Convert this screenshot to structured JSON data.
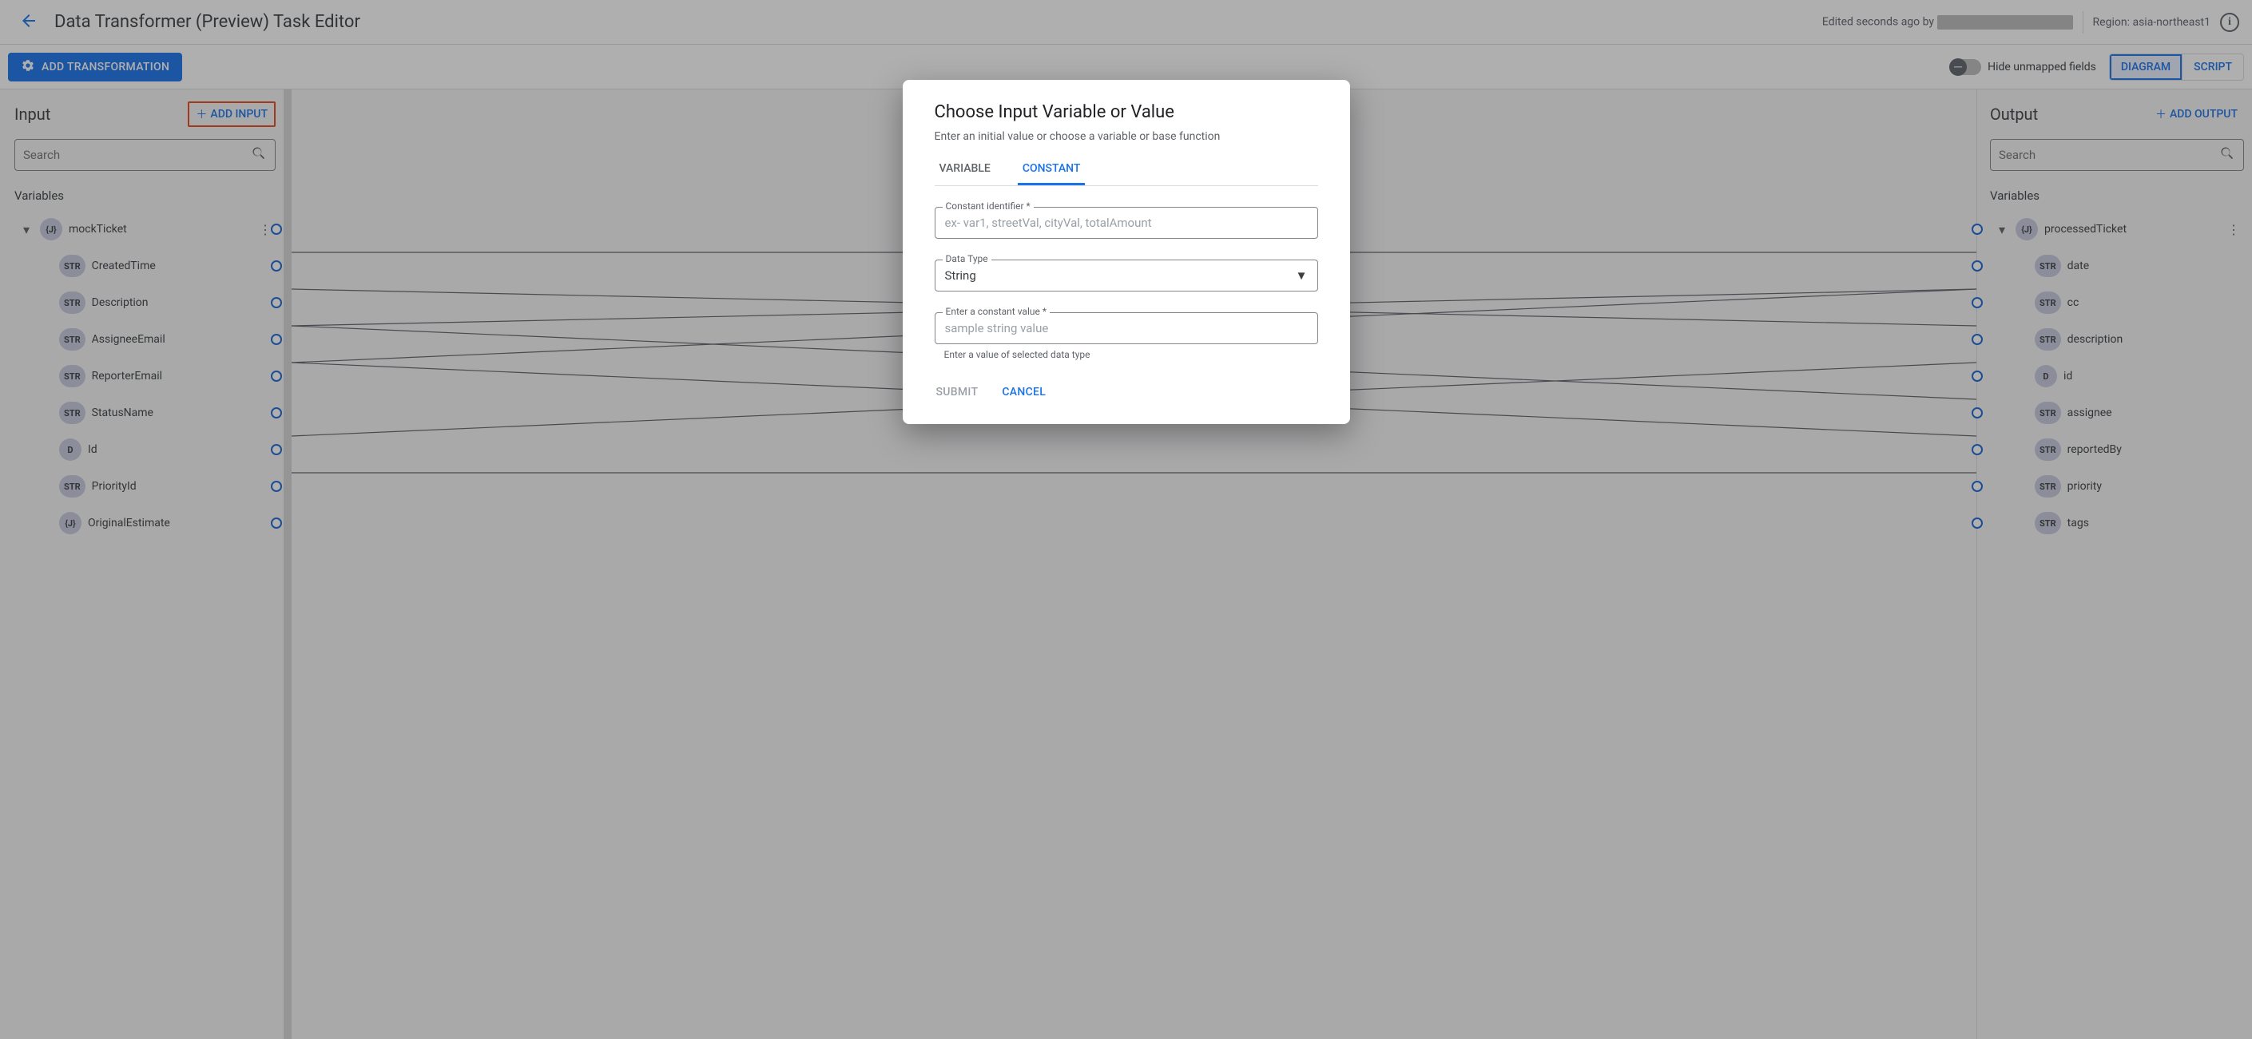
{
  "header": {
    "title": "Data Transformer (Preview) Task Editor",
    "edited_prefix": "Edited seconds ago by",
    "region_label": "Region:",
    "region_value": "asia-northeast1"
  },
  "toolbar": {
    "add_transformation": "ADD TRANSFORMATION",
    "hide_unmapped": "Hide unmapped fields",
    "view_diagram": "DIAGRAM",
    "view_script": "SCRIPT"
  },
  "input_panel": {
    "title": "Input",
    "add_btn": "ADD INPUT",
    "search_placeholder": "Search",
    "variables_label": "Variables",
    "root": {
      "type": "json",
      "name": "mockTicket"
    },
    "fields": [
      {
        "type": "STR",
        "name": "CreatedTime"
      },
      {
        "type": "STR",
        "name": "Description"
      },
      {
        "type": "STR",
        "name": "AssigneeEmail"
      },
      {
        "type": "STR",
        "name": "ReporterEmail"
      },
      {
        "type": "STR",
        "name": "StatusName"
      },
      {
        "type": "D",
        "name": "Id"
      },
      {
        "type": "STR",
        "name": "PriorityId"
      },
      {
        "type": "{J}",
        "name": "OriginalEstimate"
      }
    ]
  },
  "output_panel": {
    "title": "Output",
    "add_btn": "ADD OUTPUT",
    "search_placeholder": "Search",
    "variables_label": "Variables",
    "root": {
      "type": "json",
      "name": "processedTicket"
    },
    "fields": [
      {
        "type": "STR",
        "name": "date"
      },
      {
        "type": "STR",
        "name": "cc"
      },
      {
        "type": "STR",
        "name": "description"
      },
      {
        "type": "D",
        "name": "id"
      },
      {
        "type": "STR",
        "name": "assignee"
      },
      {
        "type": "STR",
        "name": "reportedBy"
      },
      {
        "type": "STR",
        "name": "priority"
      },
      {
        "type": "STR",
        "name": "tags"
      }
    ]
  },
  "mappings": [
    {
      "from": 0,
      "to": 0
    },
    {
      "from": 1,
      "to": 2
    },
    {
      "from": 2,
      "to": 1
    },
    {
      "from": 2,
      "to": 4
    },
    {
      "from": 3,
      "to": 1
    },
    {
      "from": 3,
      "to": 5
    },
    {
      "from": 5,
      "to": 3
    },
    {
      "from": 6,
      "to": 6
    }
  ],
  "modal": {
    "title": "Choose Input Variable or Value",
    "subtitle": "Enter an initial value or choose a variable or base function",
    "tab_variable": "VARIABLE",
    "tab_constant": "CONSTANT",
    "identifier_label": "Constant identifier *",
    "identifier_placeholder": "ex- var1, streetVal, cityVal, totalAmount",
    "datatype_label": "Data Type",
    "datatype_value": "String",
    "value_label": "Enter a constant value *",
    "value_placeholder": "sample string value",
    "value_helper": "Enter a value of selected data type",
    "submit": "SUBMIT",
    "cancel": "CANCEL"
  }
}
